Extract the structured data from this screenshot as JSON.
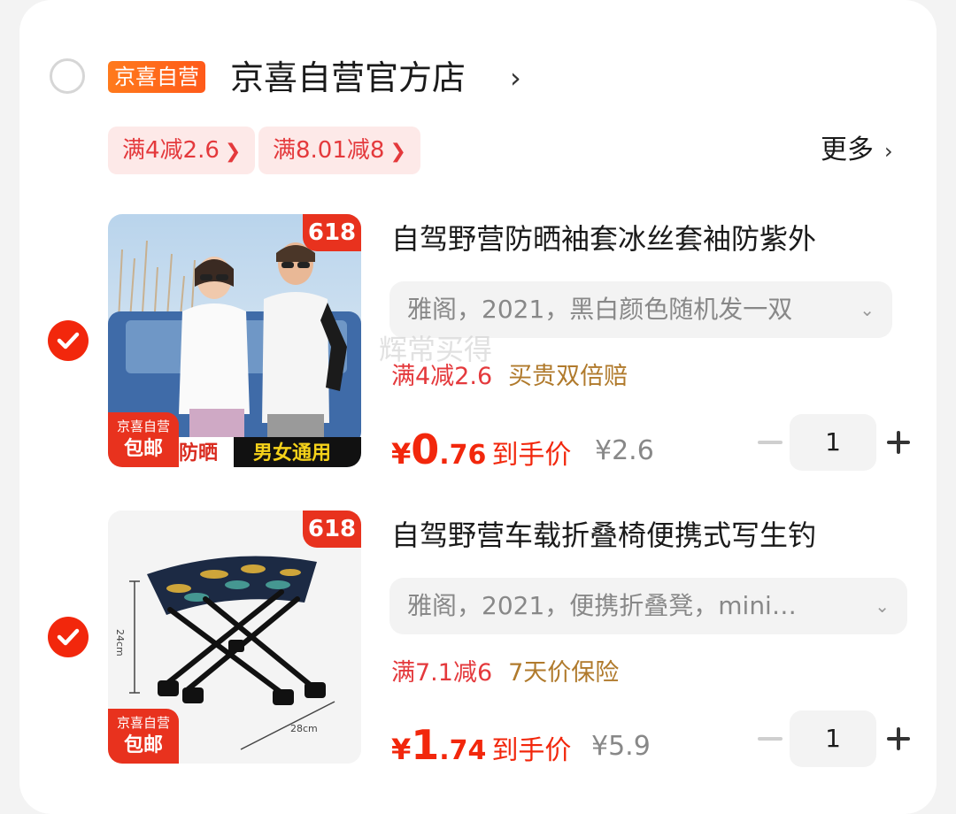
{
  "store": {
    "tag": "京喜自营",
    "name": "京喜自营官方店",
    "chevron": "›",
    "promos": [
      "满4减2.6",
      "满8.01减8"
    ],
    "more_label": "更多",
    "more_chevron": "›"
  },
  "watermark": "辉常买得",
  "products": [
    {
      "title": "自驾野营防晒袖套冰丝套袖防紫外",
      "spec": "雅阁，2021，黑白颜色随机发一双",
      "spec_icon": "chevron-down-icon",
      "promo_red": "满4减2.6",
      "promo_gold": "买贵双倍赔",
      "price_symbol": "¥",
      "price_int": "0",
      "price_dec": ".76",
      "price_label": "到手价",
      "orig_price": "¥2.6",
      "quantity": "1",
      "badge_618": "618",
      "self_badge_small": "京喜自营",
      "self_badge_big": "包邮",
      "banner_left": "防晒",
      "banner_right": "男女通用",
      "checked": true
    },
    {
      "title": "自驾野营车载折叠椅便携式写生钓",
      "spec": "雅阁，2021，便携折叠凳，mini…",
      "spec_icon": "chevron-down-icon",
      "promo_red": "满7.1减6",
      "promo_gold": "7天价保险",
      "price_symbol": "¥",
      "price_int": "1",
      "price_dec": ".74",
      "price_label": "到手价",
      "orig_price": "¥5.9",
      "quantity": "1",
      "badge_618": "618",
      "self_badge_small": "京喜自营",
      "self_badge_big": "包邮",
      "dim_height": "24cm",
      "dim_width": "28cm",
      "checked": true
    }
  ],
  "colors": {
    "accent_red": "#f2270c",
    "promo_gold": "#b07a2c",
    "store_tag": "#ff6a1a"
  }
}
